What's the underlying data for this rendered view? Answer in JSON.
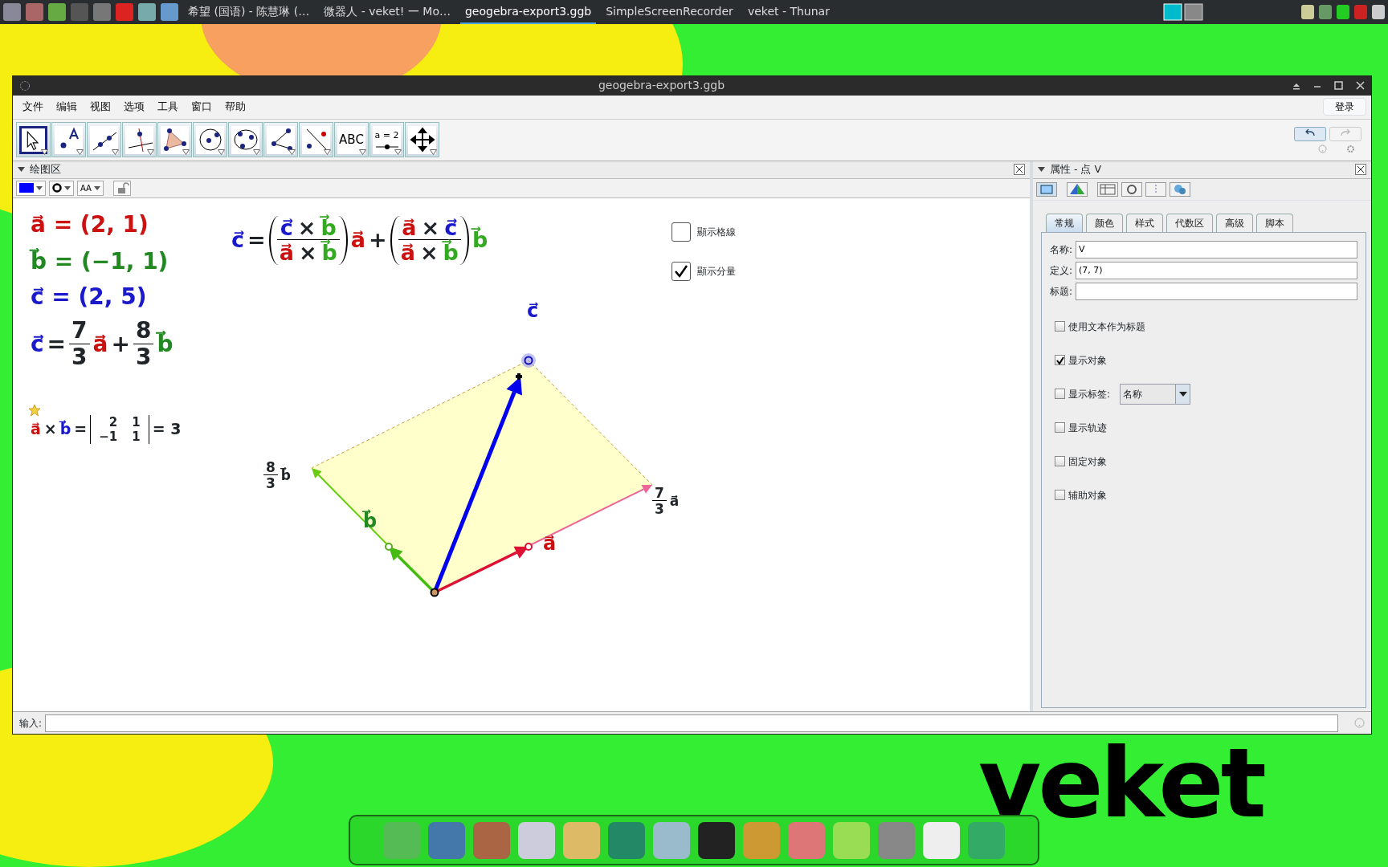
{
  "taskbar": {
    "tasks": [
      {
        "label": "希望 (国语) - 陈慧琳 (…",
        "selected": false
      },
      {
        "label": "微器人 - veket! 一 Mo…",
        "selected": false
      },
      {
        "label": "geogebra-export3.ggb",
        "selected": true
      },
      {
        "label": "SimpleScreenRecorder",
        "selected": false
      },
      {
        "label": "veket - Thunar",
        "selected": false
      }
    ]
  },
  "wallpaper": {
    "text": "veket"
  },
  "window": {
    "title": "geogebra-export3.ggb"
  },
  "menu": [
    "文件",
    "编辑",
    "视图",
    "选项",
    "工具",
    "窗口",
    "帮助"
  ],
  "login_button": "登录",
  "tools": [
    {
      "selected": true
    },
    {
      "selected": false
    },
    {
      "selected": false
    },
    {
      "selected": false
    },
    {
      "selected": false
    },
    {
      "selected": false
    },
    {
      "selected": false
    },
    {
      "selected": false
    },
    {
      "selected": false
    },
    {
      "label": "ABC",
      "selected": false
    },
    {
      "label": "a = 2",
      "selected": false
    },
    {
      "selected": false
    }
  ],
  "graphics": {
    "title": "绘图区",
    "text_size": "AA",
    "formulas": [
      {
        "parts": [
          {
            "kind": "t",
            "text": "a⃗ = (2, 1)",
            "color": "#cc1111"
          }
        ]
      },
      {
        "parts": [
          {
            "kind": "t",
            "text": "b⃗ = (−1, 1)",
            "color": "#228822"
          }
        ]
      },
      {
        "parts": [
          {
            "kind": "t",
            "text": "c⃗ = (2, 5)",
            "color": "#1a1acc"
          }
        ]
      },
      {
        "parts": [
          {
            "kind": "t",
            "text": "c⃗",
            "color": "#1a1acc"
          },
          {
            "kind": "t",
            "text": "="
          },
          {
            "kind": "frac",
            "num": [
              {
                "kind": "t",
                "text": "7"
              }
            ],
            "den": [
              {
                "kind": "t",
                "text": "3"
              }
            ]
          },
          {
            "kind": "t",
            "text": "a⃗",
            "color": "#cc1111"
          },
          {
            "kind": "t",
            "text": "+"
          },
          {
            "kind": "frac",
            "num": [
              {
                "kind": "t",
                "text": "8"
              }
            ],
            "den": [
              {
                "kind": "t",
                "text": "3"
              }
            ]
          },
          {
            "kind": "t",
            "text": "b⃗",
            "color": "#228822"
          }
        ]
      },
      {
        "parts": [
          {
            "kind": "t",
            "text": "a⃗",
            "color": "#cc1111"
          },
          {
            "kind": "t",
            "text": "×"
          },
          {
            "kind": "t",
            "text": "b⃗",
            "color": "#1a1acc"
          },
          {
            "kind": "t",
            "text": "="
          },
          {
            "kind": "det",
            "rows": [
              [
                "2",
                "1"
              ],
              [
                "−1",
                "1"
              ]
            ]
          },
          {
            "kind": "t",
            "text": "= 3"
          }
        ]
      },
      {
        "parts": [
          {
            "kind": "t",
            "text": "c⃗",
            "color": "#1a1acc"
          },
          {
            "kind": "t",
            "text": "="
          },
          {
            "kind": "paren",
            "parts": [
              {
                "kind": "frac",
                "num": [
                  {
                    "kind": "t",
                    "text": "c⃗",
                    "color": "#1a1acc"
                  },
                  {
                    "kind": "t",
                    "text": "×"
                  },
                  {
                    "kind": "t",
                    "text": "b⃗",
                    "color": "#33aa22"
                  }
                ],
                "den": [
                  {
                    "kind": "t",
                    "text": "a⃗",
                    "color": "#cc1111"
                  },
                  {
                    "kind": "t",
                    "text": "×"
                  },
                  {
                    "kind": "t",
                    "text": "b⃗",
                    "color": "#33aa22"
                  }
                ]
              }
            ]
          },
          {
            "kind": "t",
            "text": "a⃗",
            "color": "#cc1111"
          },
          {
            "kind": "t",
            "text": "+"
          },
          {
            "kind": "paren",
            "parts": [
              {
                "kind": "frac",
                "num": [
                  {
                    "kind": "t",
                    "text": "a⃗",
                    "color": "#cc1111"
                  },
                  {
                    "kind": "t",
                    "text": "×"
                  },
                  {
                    "kind": "t",
                    "text": "c⃗",
                    "color": "#1a1acc"
                  }
                ],
                "den": [
                  {
                    "kind": "t",
                    "text": "a⃗",
                    "color": "#cc1111"
                  },
                  {
                    "kind": "t",
                    "text": "×"
                  },
                  {
                    "kind": "t",
                    "text": "b⃗",
                    "color": "#33aa22"
                  }
                ]
              }
            ]
          },
          {
            "kind": "t",
            "text": "b⃗",
            "color": "#33aa22"
          }
        ]
      },
      {
        "parts": [
          {
            "kind": "t",
            "text": "c⃗",
            "color": "#1a1acc"
          }
        ]
      },
      {
        "parts": [
          {
            "kind": "t",
            "text": "b⃗",
            "color": "#228822"
          }
        ]
      },
      {
        "parts": [
          {
            "kind": "t",
            "text": "a⃗",
            "color": "#cc1111"
          }
        ]
      },
      {
        "parts": [
          {
            "kind": "frac",
            "num": [
              {
                "kind": "t",
                "text": "8"
              }
            ],
            "den": [
              {
                "kind": "t",
                "text": "3"
              }
            ]
          },
          {
            "kind": "t",
            "text": "b⃗"
          }
        ]
      },
      {
        "parts": [
          {
            "kind": "frac",
            "num": [
              {
                "kind": "t",
                "text": "7"
              }
            ],
            "den": [
              {
                "kind": "t",
                "text": "3"
              }
            ]
          },
          {
            "kind": "t",
            "text": "a⃗"
          }
        ]
      }
    ],
    "checkboxes": [
      {
        "label": "顯示格線",
        "checked": false
      },
      {
        "label": "顯示分量",
        "checked": true
      }
    ]
  },
  "properties": {
    "title": "属性 - 点 V",
    "tabs": [
      {
        "label": "常规",
        "selected": true
      },
      {
        "label": "颜色",
        "selected": false
      },
      {
        "label": "样式",
        "selected": false
      },
      {
        "label": "代数区",
        "selected": false
      },
      {
        "label": "高级",
        "selected": false
      },
      {
        "label": "脚本",
        "selected": false
      }
    ],
    "fields": [
      {
        "label": "名称:",
        "value": "V"
      },
      {
        "label": "定义:",
        "value": "(7, 7)"
      },
      {
        "label": "标题:"
      }
    ],
    "checkboxes": [
      {
        "label": "使用文本作为标题",
        "checked": false
      },
      {
        "label": "显示对象",
        "checked": true
      },
      {
        "label": "显示标签:",
        "checked": false,
        "dropdown": "名称"
      },
      {
        "label": "显示轨迹",
        "checked": false
      },
      {
        "label": "固定对象",
        "checked": false
      },
      {
        "label": "辅助对象",
        "checked": false
      }
    ]
  },
  "input_bar": {
    "label": "输入:"
  }
}
